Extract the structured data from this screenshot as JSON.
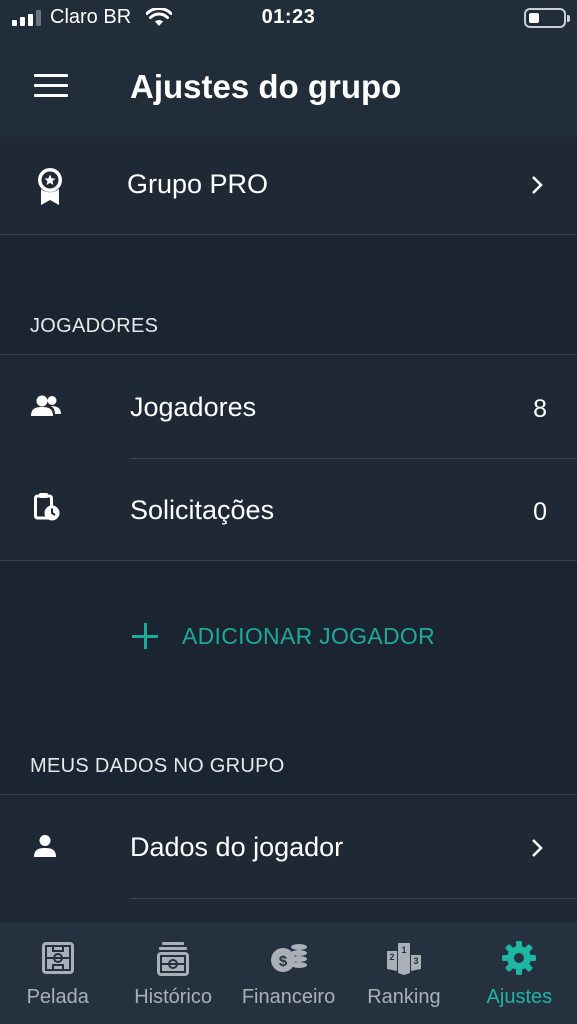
{
  "status_bar": {
    "carrier": "Claro BR",
    "time": "01:23"
  },
  "header": {
    "title": "Ajustes do grupo",
    "menu_icon": "hamburger-menu-icon"
  },
  "pro_row": {
    "label": "Grupo PRO",
    "icon": "award-ribbon-icon"
  },
  "jogadores_section": {
    "header": "JOGADORES",
    "rows": [
      {
        "label": "Jogadores",
        "count": "8",
        "icon": "people-icon"
      },
      {
        "label": "Solicitações",
        "count": "0",
        "icon": "clipboard-clock-icon"
      }
    ],
    "add_button": "ADICIONAR JOGADOR"
  },
  "meus_dados_section": {
    "header": "MEUS DADOS NO GRUPO",
    "rows": [
      {
        "label": "Dados do jogador",
        "icon": "person-icon"
      }
    ]
  },
  "tabs": [
    {
      "label": "Pelada",
      "icon": "field-icon",
      "active": false
    },
    {
      "label": "Histórico",
      "icon": "history-field-icon",
      "active": false
    },
    {
      "label": "Financeiro",
      "icon": "coins-icon",
      "active": false
    },
    {
      "label": "Ranking",
      "icon": "podium-icon",
      "active": false
    },
    {
      "label": "Ajustes",
      "icon": "gear-icon",
      "active": true
    }
  ],
  "colors": {
    "accent": "#1fa99a",
    "background": "#1b2531",
    "row_background": "#1f2935",
    "header_background": "#222d3a",
    "tabbar_background": "#263140"
  }
}
